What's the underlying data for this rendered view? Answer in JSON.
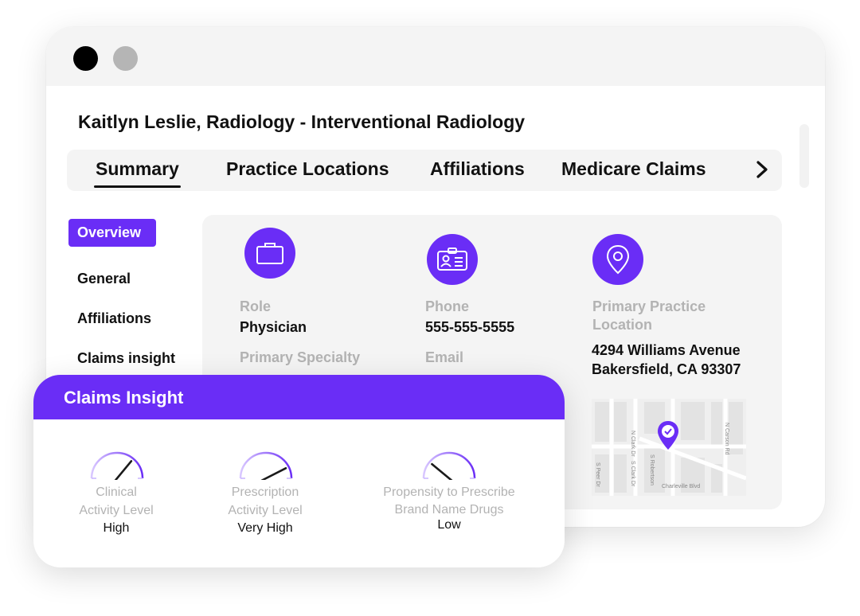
{
  "window": {
    "title": "Kaitlyn Leslie, Radiology - Interventional Radiology"
  },
  "tabs": [
    {
      "label": "Summary",
      "active": true
    },
    {
      "label": "Practice Locations"
    },
    {
      "label": "Affiliations"
    },
    {
      "label": "Medicare Claims"
    }
  ],
  "subnav": [
    {
      "label": "Overview",
      "active": true
    },
    {
      "label": "General"
    },
    {
      "label": "Affiliations"
    },
    {
      "label": "Claims insight"
    }
  ],
  "overview": {
    "role_label": "Role",
    "role_value": "Physician",
    "specialty_label": "Primary Specialty",
    "phone_label": "Phone",
    "phone_value": "555-555-5555",
    "email_label": "Email",
    "location_label": "Primary Practice Location",
    "address_line1": "4294 Williams Avenue",
    "address_line2": "Bakersfield, CA 93307"
  },
  "map": {
    "streets": [
      "N Clark Dr",
      "N Carson Rd",
      "S Peer Dr",
      "S Clark Dr",
      "S Robertson",
      "Charleville Blvd"
    ]
  },
  "claims_insight": {
    "title": "Claims Insight",
    "gauges": [
      {
        "label_line1": "Clinical",
        "label_line2": "Activity Level",
        "value": "High",
        "level": 0.72
      },
      {
        "label_line1": "Prescription",
        "label_line2": "Activity Level",
        "value": "Very High",
        "level": 0.85
      },
      {
        "label_line1": "Propensity to Prescribe",
        "label_line2": "Brand Name Drugs",
        "value": "Low",
        "level": 0.22
      }
    ]
  },
  "colors": {
    "accent": "#6a2df6",
    "muted_text": "#b3b3b3",
    "panel_bg": "#f4f4f4"
  },
  "icons": [
    "briefcase-icon",
    "id-card-icon",
    "location-pin-icon",
    "chevron-right-icon",
    "map-pin-check-icon"
  ]
}
